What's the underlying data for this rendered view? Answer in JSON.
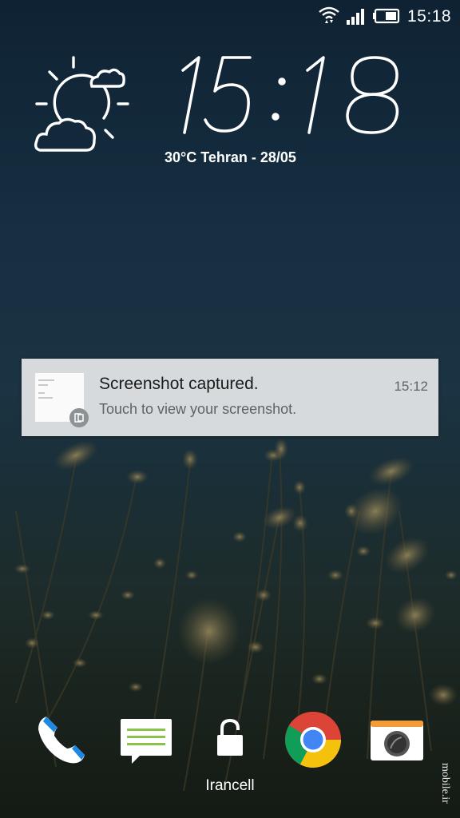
{
  "status_bar": {
    "time": "15:18",
    "icons": [
      "wifi-icon",
      "signal-icon",
      "battery-icon"
    ]
  },
  "clock": {
    "time": "15:18",
    "weather_icon": "partly-cloudy-icon",
    "weather_text": "30°C Tehran - 28/05"
  },
  "notification": {
    "title": "Screenshot captured.",
    "body": "Touch to view your screenshot.",
    "time": "15:12",
    "thumbnail_icon": "screenshot-thumbnail",
    "badge_icon": "screenshot-app-icon"
  },
  "dock": {
    "apps": [
      {
        "name": "Phone",
        "icon": "phone-icon"
      },
      {
        "name": "Messages",
        "icon": "messages-icon"
      },
      {
        "name": "Unlock",
        "icon": "unlock-icon"
      },
      {
        "name": "Chrome",
        "icon": "chrome-icon"
      },
      {
        "name": "Camera",
        "icon": "camera-icon"
      }
    ],
    "carrier": "Irancell"
  },
  "watermark": "mobile.ir",
  "colors": {
    "notification_bg": "#d6dadd",
    "phone_accent": "#1e88e5",
    "messages_accent": "#8bc34a"
  }
}
